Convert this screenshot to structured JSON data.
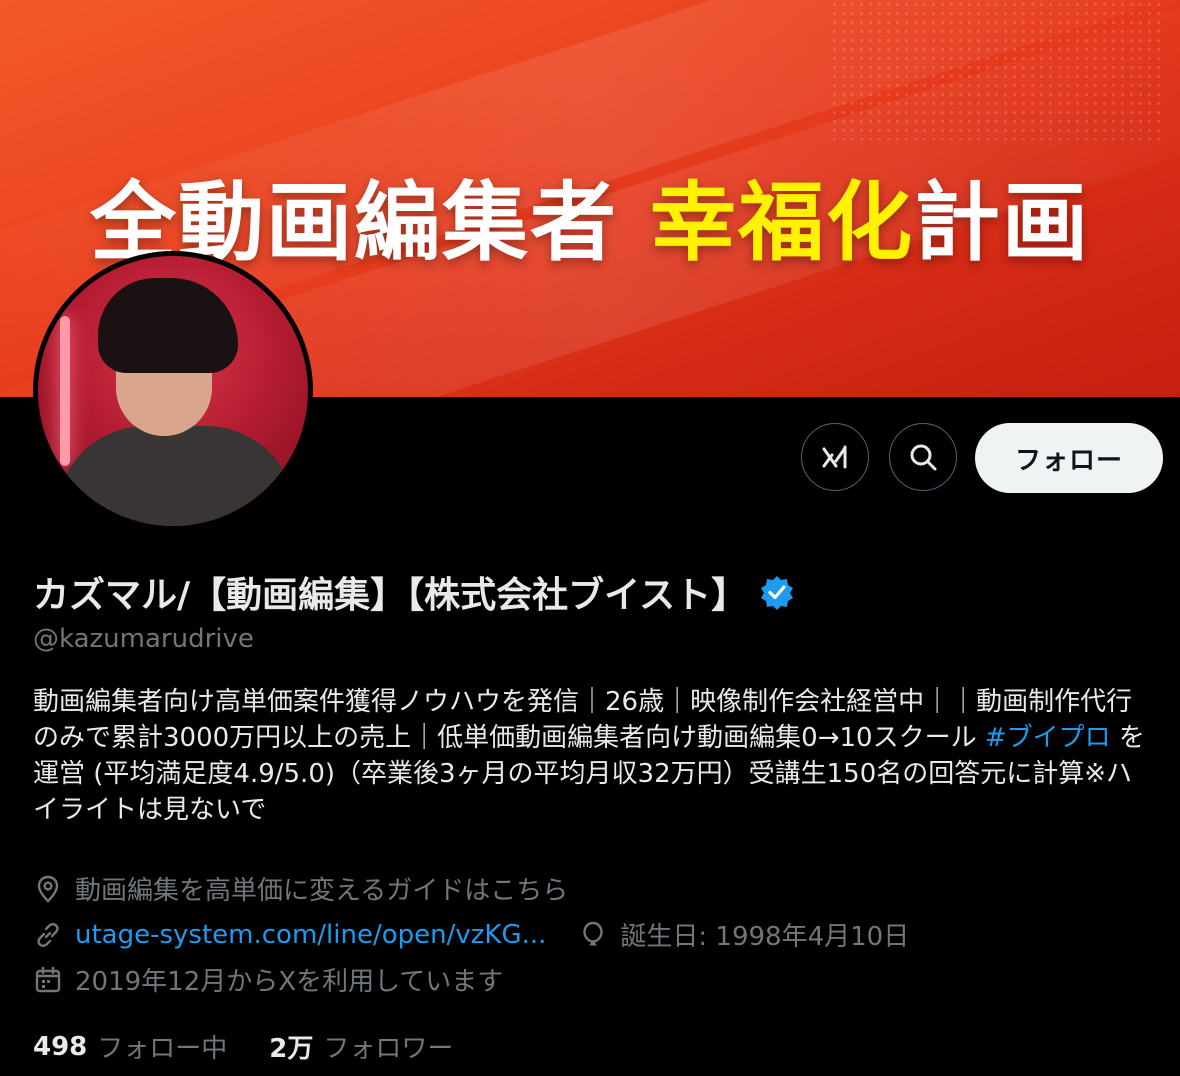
{
  "banner": {
    "title_white": "全動画編集者 ",
    "title_yellow": "幸福化",
    "title_white2": "計画",
    "colors": {
      "red": "#e63a1d",
      "yellow": "#fff200"
    }
  },
  "profile": {
    "display_name": "カズマル/【動画編集】【株式会社ブイスト】",
    "handle": "@kazumarudrive",
    "verified_icon": "verified-badge-icon",
    "bio_part1": "動画編集者向け高単価案件獲得ノウハウを発信｜26歳｜映像制作会社経営中｜｜動画制作代行のみで累計3000万円以上の売上｜低単価動画編集者向け動画編集0→10スクール ",
    "bio_hashtag": "#ブイプロ",
    "bio_part2": " を運営 (平均満足度4.9/5.0)（卒業後3ヶ月の平均月収32万円）受講生150名の回答元に計算※ハイライトは見ないで"
  },
  "actions": {
    "grok_icon": "grok-icon",
    "search_icon": "search-icon",
    "follow_label": "フォロー"
  },
  "meta": {
    "location": "動画編集を高単価に変えるガイドはこちら",
    "url": "utage-system.com/line/open/vzKG...",
    "birthday": "誕生日: 1998年4月10日",
    "joined": "2019年12月からXを利用しています"
  },
  "counts": {
    "following_num": "498",
    "following_label": "フォロー中",
    "followers_num": "2万",
    "followers_label": "フォロワー"
  }
}
